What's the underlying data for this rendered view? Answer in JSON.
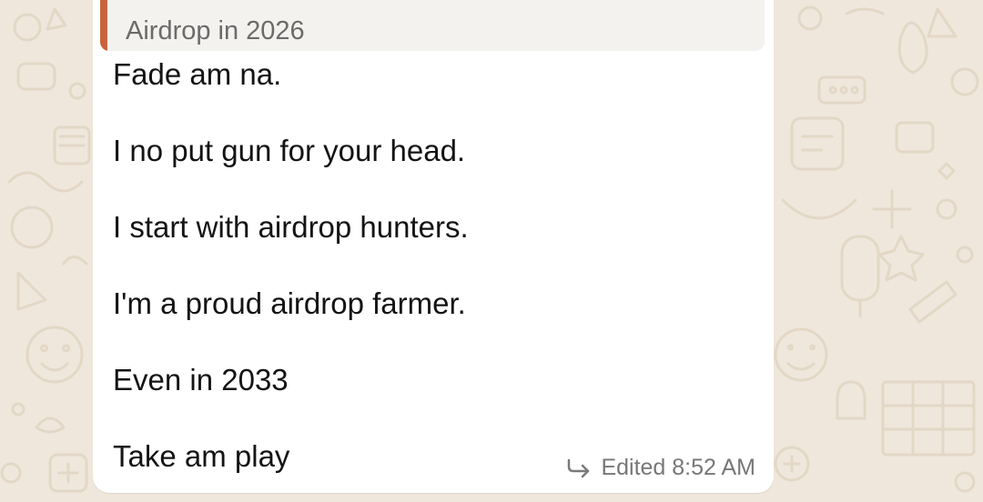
{
  "quoted": {
    "text": "Airdrop in 2026",
    "accent_color": "#c8643c"
  },
  "message": {
    "lines": [
      "Fade am na.",
      "I no put gun for your head.",
      "I start with airdrop hunters.",
      "I'm a proud airdrop farmer.",
      "Even in 2033",
      "Take am play"
    ]
  },
  "meta": {
    "edited_time": "Edited 8:52 AM",
    "icon": "forward-icon"
  },
  "colors": {
    "wallpaper": "#efe7dc",
    "bubble": "#ffffff",
    "text": "#141414",
    "meta_text": "#777777"
  }
}
